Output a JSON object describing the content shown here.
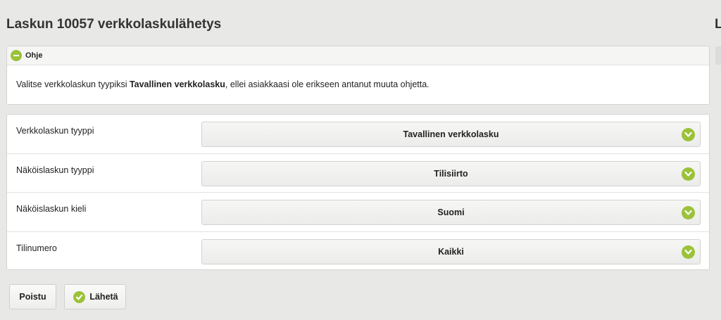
{
  "page": {
    "title": "Laskun 10057 verkkolaskulähetys",
    "right_peek_title": "L"
  },
  "help": {
    "title": "Ohje",
    "text_before": "Valitse verkkolaskun tyypiksi ",
    "text_bold": "Tavallinen verkkolasku",
    "text_after": ", ellei asiakkaasi ole erikseen antanut muuta ohjetta."
  },
  "form": {
    "rows": [
      {
        "label": "Verkkolaskun tyyppi",
        "value": "Tavallinen verkkolasku"
      },
      {
        "label": "Näköislaskun tyyppi",
        "value": "Tilisiirto"
      },
      {
        "label": "Näköislaskun kieli",
        "value": "Suomi"
      },
      {
        "label": "Tilinumero",
        "value": "Kaikki"
      }
    ]
  },
  "buttons": {
    "exit_label": "Poistu",
    "send_label": "Lähetä"
  },
  "colors": {
    "accent": "#9bc23a",
    "background": "#e8e8e6"
  },
  "icons": {
    "collapse": "minus-circle-icon",
    "dropdown": "chevron-down-icon",
    "confirm": "check-icon"
  }
}
